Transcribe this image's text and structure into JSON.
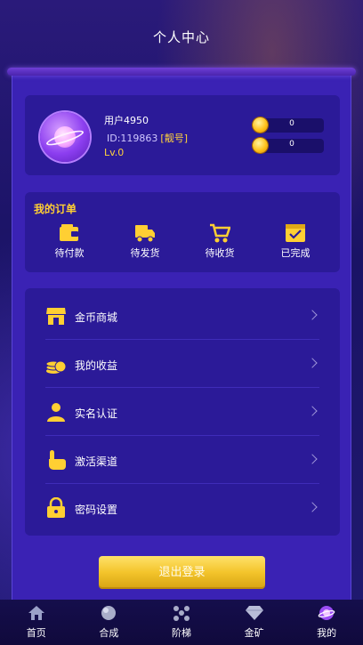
{
  "header": {
    "title": "个人中心"
  },
  "profile": {
    "username": "用户4950",
    "user_id": "ID:119863",
    "id_tag": "[靓号]",
    "level": "Lv.0",
    "balances": [
      {
        "value": "0"
      },
      {
        "value": "0"
      }
    ]
  },
  "orders": {
    "title": "我的订单",
    "items": [
      {
        "label": "待付款",
        "icon": "wallet-icon"
      },
      {
        "label": "待发货",
        "icon": "truck-icon"
      },
      {
        "label": "待收货",
        "icon": "cart-icon"
      },
      {
        "label": "已完成",
        "icon": "checked-box-icon"
      }
    ]
  },
  "menu": {
    "items": [
      {
        "label": "金币商城",
        "icon": "shop-icon"
      },
      {
        "label": "我的收益",
        "icon": "coins-icon"
      },
      {
        "label": "实名认证",
        "icon": "user-verify-icon"
      },
      {
        "label": "激活渠道",
        "icon": "hand-pointer-icon"
      },
      {
        "label": "密码设置",
        "icon": "lock-icon"
      }
    ]
  },
  "logout_label": "退出登录",
  "tabbar": {
    "items": [
      {
        "label": "首页",
        "icon": "home-icon"
      },
      {
        "label": "合成",
        "icon": "sphere-icon"
      },
      {
        "label": "阶梯",
        "icon": "nodes-icon"
      },
      {
        "label": "金矿",
        "icon": "diamond-icon"
      },
      {
        "label": "我的",
        "icon": "planet-icon"
      }
    ],
    "active_index": 4
  },
  "colors": {
    "accent_gold": "#ffcf33",
    "panel": "#3a22b4",
    "card": "#2b1a98"
  }
}
